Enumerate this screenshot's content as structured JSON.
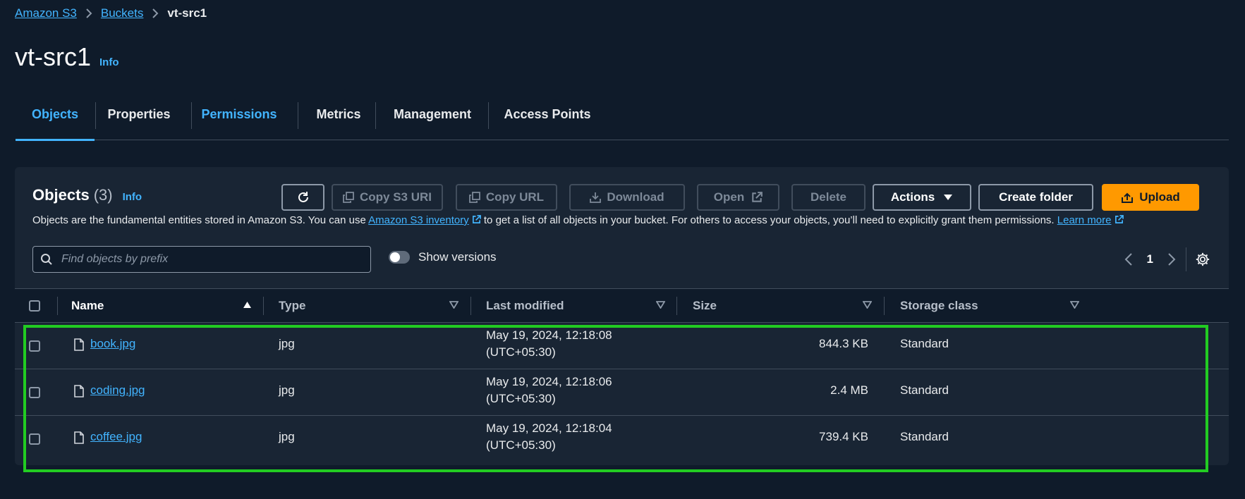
{
  "breadcrumb": {
    "root": "Amazon S3",
    "buckets": "Buckets",
    "current": "vt-src1"
  },
  "header": {
    "title": "vt-src1",
    "info": "Info"
  },
  "tabs": [
    "Objects",
    "Properties",
    "Permissions",
    "Metrics",
    "Management",
    "Access Points"
  ],
  "panel": {
    "title": "Objects",
    "count": "(3)",
    "info": "Info",
    "description_pre": "Objects are the fundamental entities stored in Amazon S3. You can use ",
    "inventory_link": "Amazon S3 inventory",
    "description_mid": " to get a list of all objects in your bucket. For others to access your objects, you’ll need to explicitly grant them permissions.",
    "learn_more": "Learn more"
  },
  "toolbar": {
    "copy_uri": "Copy S3 URI",
    "copy_url": "Copy URL",
    "download": "Download",
    "open": "Open",
    "delete": "Delete",
    "actions": "Actions",
    "create_folder": "Create folder",
    "upload": "Upload"
  },
  "search": {
    "placeholder": "Find objects by prefix"
  },
  "versions": {
    "label": "Show versions"
  },
  "pager": {
    "page": "1"
  },
  "table": {
    "columns": [
      "Name",
      "Type",
      "Last modified",
      "Size",
      "Storage class"
    ],
    "rows": [
      {
        "name": "book.jpg",
        "type": "jpg",
        "modified_date": "May 19, 2024, 12:18:08",
        "modified_tz": "(UTC+05:30)",
        "size": "844.3 KB",
        "storage": "Standard"
      },
      {
        "name": "coding.jpg",
        "type": "jpg",
        "modified_date": "May 19, 2024, 12:18:06",
        "modified_tz": "(UTC+05:30)",
        "size": "2.4 MB",
        "storage": "Standard"
      },
      {
        "name": "coffee.jpg",
        "type": "jpg",
        "modified_date": "May 19, 2024, 12:18:04",
        "modified_tz": "(UTC+05:30)",
        "size": "739.4 KB",
        "storage": "Standard"
      }
    ]
  },
  "colors": {
    "background": "#0f1b2a",
    "panel": "#192534",
    "accent": "#42b4ff",
    "primary": "#ff9900",
    "highlight": "#22cc22"
  }
}
